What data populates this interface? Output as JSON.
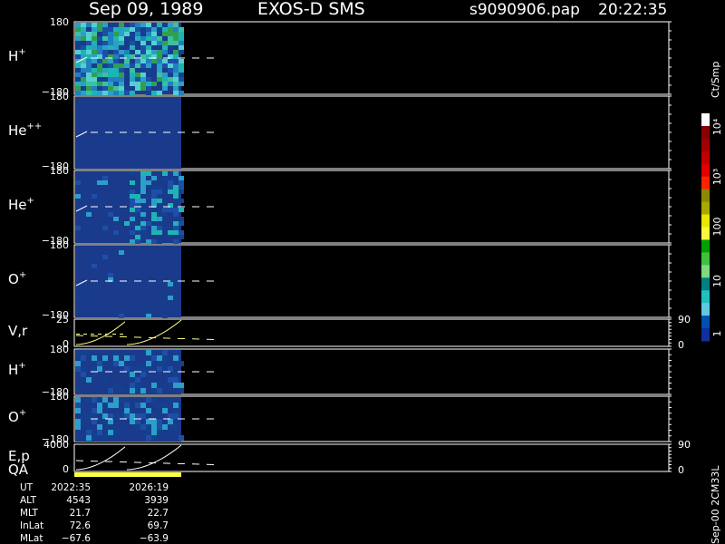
{
  "header": {
    "date": "Sep 09, 1989",
    "instrument": "EXOS-D SMS",
    "file": "s9090906.pap",
    "time": "20:22:35"
  },
  "colorbar": {
    "unit_label": "Ct/Smp",
    "tick_labels": [
      "10⁴",
      "10³",
      "100",
      "10",
      "1"
    ],
    "colors": [
      "#ffffff",
      "#8a0000",
      "#a00000",
      "#c00000",
      "#e00000",
      "#ff2200",
      "#8a8a00",
      "#a8a800",
      "#e8e800",
      "#f8f840",
      "#00a000",
      "#40c040",
      "#80d880",
      "#008080",
      "#20c0c0",
      "#60c8e0",
      "#0050b0",
      "#1030a0"
    ]
  },
  "colors": {
    "background": "#000000",
    "frame": "#ffffff",
    "empty_bin": "#1a3a8c",
    "trace_yellow": "#ffff88",
    "qa_bar": "#ffff44"
  },
  "chart_data": [
    {
      "type": "heatmap",
      "panel": "H+",
      "label": "H",
      "sup": "+",
      "ylim": [
        -180,
        180
      ],
      "y_ticks": [
        "180",
        "−180"
      ],
      "data_extent": [
        "2022:35",
        "2026:19"
      ],
      "note_colors": [
        "#1d4fa8",
        "#14408f",
        "#2aa0c8",
        "#1fb4b4",
        "#3cc0a0",
        "#2080c0",
        "#30a050",
        "#55d0d0"
      ]
    },
    {
      "type": "heatmap",
      "panel": "He++",
      "label": "He",
      "sup": "++",
      "ylim": [
        -180,
        180
      ],
      "y_ticks": [
        "180",
        "−180"
      ],
      "data_extent": [
        "2022:35",
        "2026:19"
      ]
    },
    {
      "type": "heatmap",
      "panel": "He+",
      "label": "He",
      "sup": "+",
      "ylim": [
        -180,
        180
      ],
      "y_ticks": [
        "180",
        "−180"
      ],
      "data_extent": [
        "2022:35",
        "2026:19"
      ]
    },
    {
      "type": "heatmap",
      "panel": "O+",
      "label": "O",
      "sup": "+",
      "ylim": [
        -180,
        180
      ],
      "y_ticks": [
        "180",
        "−180"
      ],
      "data_extent": [
        "2022:35",
        "2026:19"
      ]
    },
    {
      "type": "line",
      "panel": "V,r",
      "label": "V,r",
      "ylim": [
        0,
        25
      ],
      "y_ticks": [
        "25",
        "0"
      ],
      "right_ticks": [
        "90",
        "0"
      ]
    },
    {
      "type": "heatmap",
      "panel": "H+ (lower)",
      "label": "H",
      "sup": "+",
      "ylim": [
        -180,
        180
      ],
      "y_ticks": [
        "180",
        "−180"
      ]
    },
    {
      "type": "heatmap",
      "panel": "O+ (lower)",
      "label": "O",
      "sup": "+",
      "ylim": [
        -180,
        180
      ],
      "y_ticks": [
        "180",
        "−180"
      ]
    },
    {
      "type": "line",
      "panel": "E,p",
      "label": "E,p",
      "label2": "QA",
      "ylim": [
        0,
        4000
      ],
      "y_ticks": [
        "4000",
        "0"
      ],
      "right_ticks": [
        "90",
        "0"
      ]
    }
  ],
  "footer": {
    "rows": [
      {
        "name": "UT",
        "v1": "2022:35",
        "v2": "2026:19"
      },
      {
        "name": "ALT",
        "v1": "4543",
        "v2": "3939"
      },
      {
        "name": "MLT",
        "v1": "21.7",
        "v2": "22.7"
      },
      {
        "name": "InLat",
        "v1": "72.6",
        "v2": "69.7"
      },
      {
        "name": "MLat",
        "v1": "−67.6",
        "v2": "−63.9"
      }
    ],
    "vertical_label": "Sep-00 2CM33L"
  }
}
